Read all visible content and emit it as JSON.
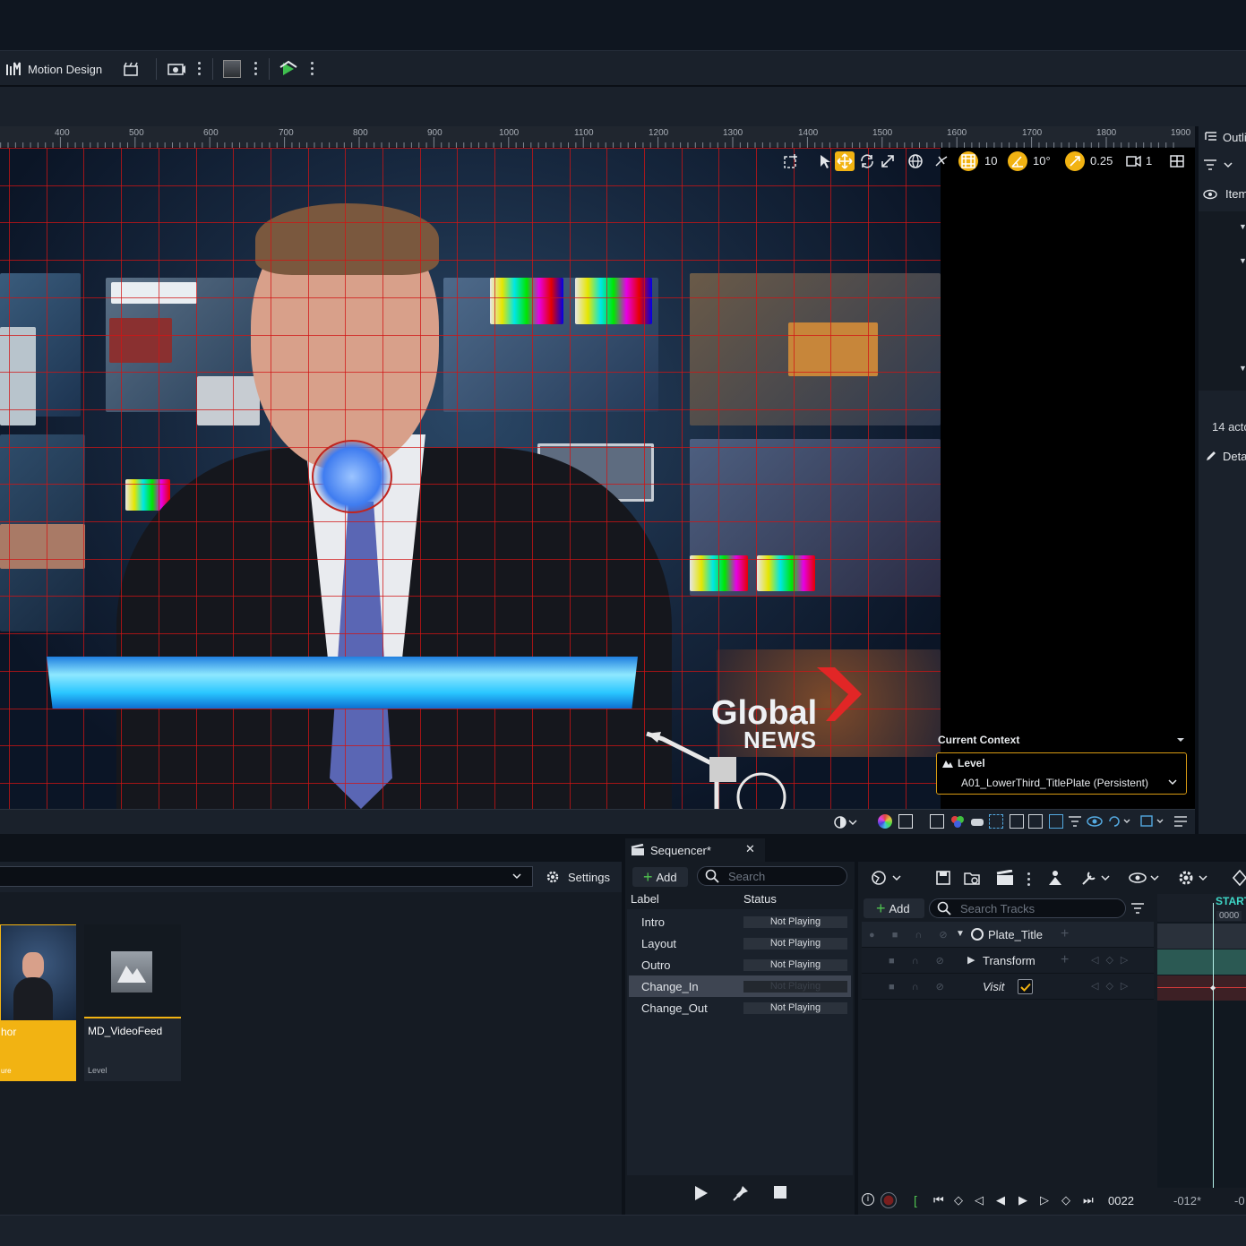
{
  "toolbar": {
    "mode_label": "Motion Design"
  },
  "ruler": {
    "ticks": [
      "400",
      "500",
      "600",
      "700",
      "800",
      "900",
      "1000",
      "1100",
      "1200",
      "1300",
      "1400",
      "1500",
      "1600",
      "1700",
      "1800",
      "1900"
    ]
  },
  "viewport_toolbar": {
    "grid_snap": "10",
    "rotation_snap": "10°",
    "scale_snap": "0.25",
    "camera_speed": "1"
  },
  "broadcast": {
    "logo_line1": "Global",
    "logo_line2": "NEWS"
  },
  "context": {
    "title": "Current Context",
    "type_label": "Level",
    "level_value": "A01_LowerThird_TitlePlate (Persistent)"
  },
  "outliner": {
    "tab_label": "Outli",
    "column_label": "Item",
    "actor_count": "14 acto",
    "details_label": "Deta"
  },
  "content_browser": {
    "settings_label": "Settings",
    "assets": [
      {
        "name": "hor",
        "type": "ure"
      },
      {
        "name": "MD_VideoFeed",
        "type": "Level"
      }
    ]
  },
  "sequencer": {
    "tab_label": "Sequencer*",
    "add_label": "Add",
    "search_placeholder": "Search",
    "col_label": "Label",
    "col_status": "Status",
    "rows": [
      {
        "label": "Intro",
        "status": "Not Playing"
      },
      {
        "label": "Layout",
        "status": "Not Playing"
      },
      {
        "label": "Outro",
        "status": "Not Playing"
      },
      {
        "label": "Change_In",
        "status": "Not Playing"
      },
      {
        "label": "Change_Out",
        "status": "Not Playing"
      }
    ]
  },
  "timeline": {
    "add_label": "Add",
    "search_placeholder": "Search Tracks",
    "tracks": [
      {
        "label": "Plate_Title"
      },
      {
        "label": "Transform"
      },
      {
        "label": "Visit"
      }
    ],
    "start_label": "START",
    "start_frame": "0000",
    "current_frame": "0022",
    "range_start": "-012*",
    "range_end": "-0"
  },
  "colors": {
    "accent": "#f2b312",
    "panel": "#151b23",
    "grid": "#d21414",
    "lower_third": "#29c6ff"
  }
}
